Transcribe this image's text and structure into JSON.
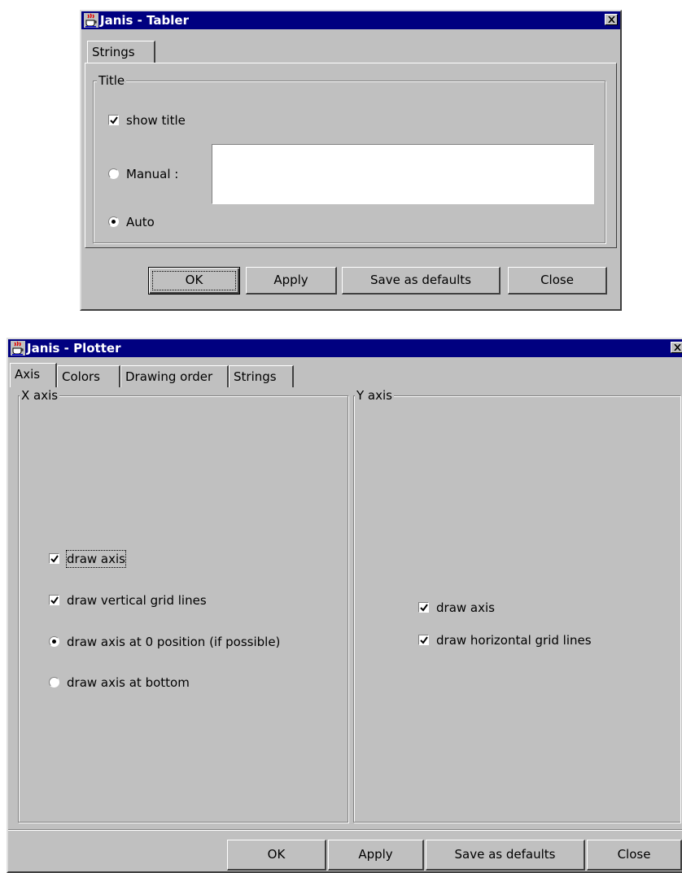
{
  "tabler": {
    "title": "Janis - Tabler",
    "tabs": [
      "Strings"
    ],
    "group_title": "Title",
    "show_title": {
      "label": "show title",
      "checked": true
    },
    "manual": {
      "label": "Manual :",
      "selected": false,
      "value": ""
    },
    "auto": {
      "label": "Auto",
      "selected": true
    },
    "buttons": {
      "ok": "OK",
      "apply": "Apply",
      "save": "Save as defaults",
      "close": "Close"
    }
  },
  "plotter": {
    "title": "Janis - Plotter",
    "tabs": [
      "Axis",
      "Colors",
      "Drawing order",
      "Strings"
    ],
    "x_axis": {
      "title": "X axis",
      "draw_axis": {
        "label": "draw axis",
        "checked": true
      },
      "vertical_grid": {
        "label": "draw vertical grid lines",
        "checked": true
      },
      "axis_at_zero": {
        "label": "draw axis at 0 position (if possible)",
        "selected": true
      },
      "axis_at_bottom": {
        "label": "draw axis at bottom",
        "selected": false
      }
    },
    "y_axis": {
      "title": "Y axis",
      "draw_axis": {
        "label": "draw axis",
        "checked": true
      },
      "horizontal_grid": {
        "label": "draw horizontal grid lines",
        "checked": true
      }
    },
    "buttons": {
      "ok": "OK",
      "apply": "Apply",
      "save": "Save as defaults",
      "close": "Close"
    }
  },
  "colors": {
    "title_bar": "#000080",
    "face": "#c0c0c0"
  },
  "icons": {
    "app": "java-cup-icon",
    "close": "close-icon",
    "check": "checkmark-icon",
    "radio": "radio-dot-icon"
  }
}
